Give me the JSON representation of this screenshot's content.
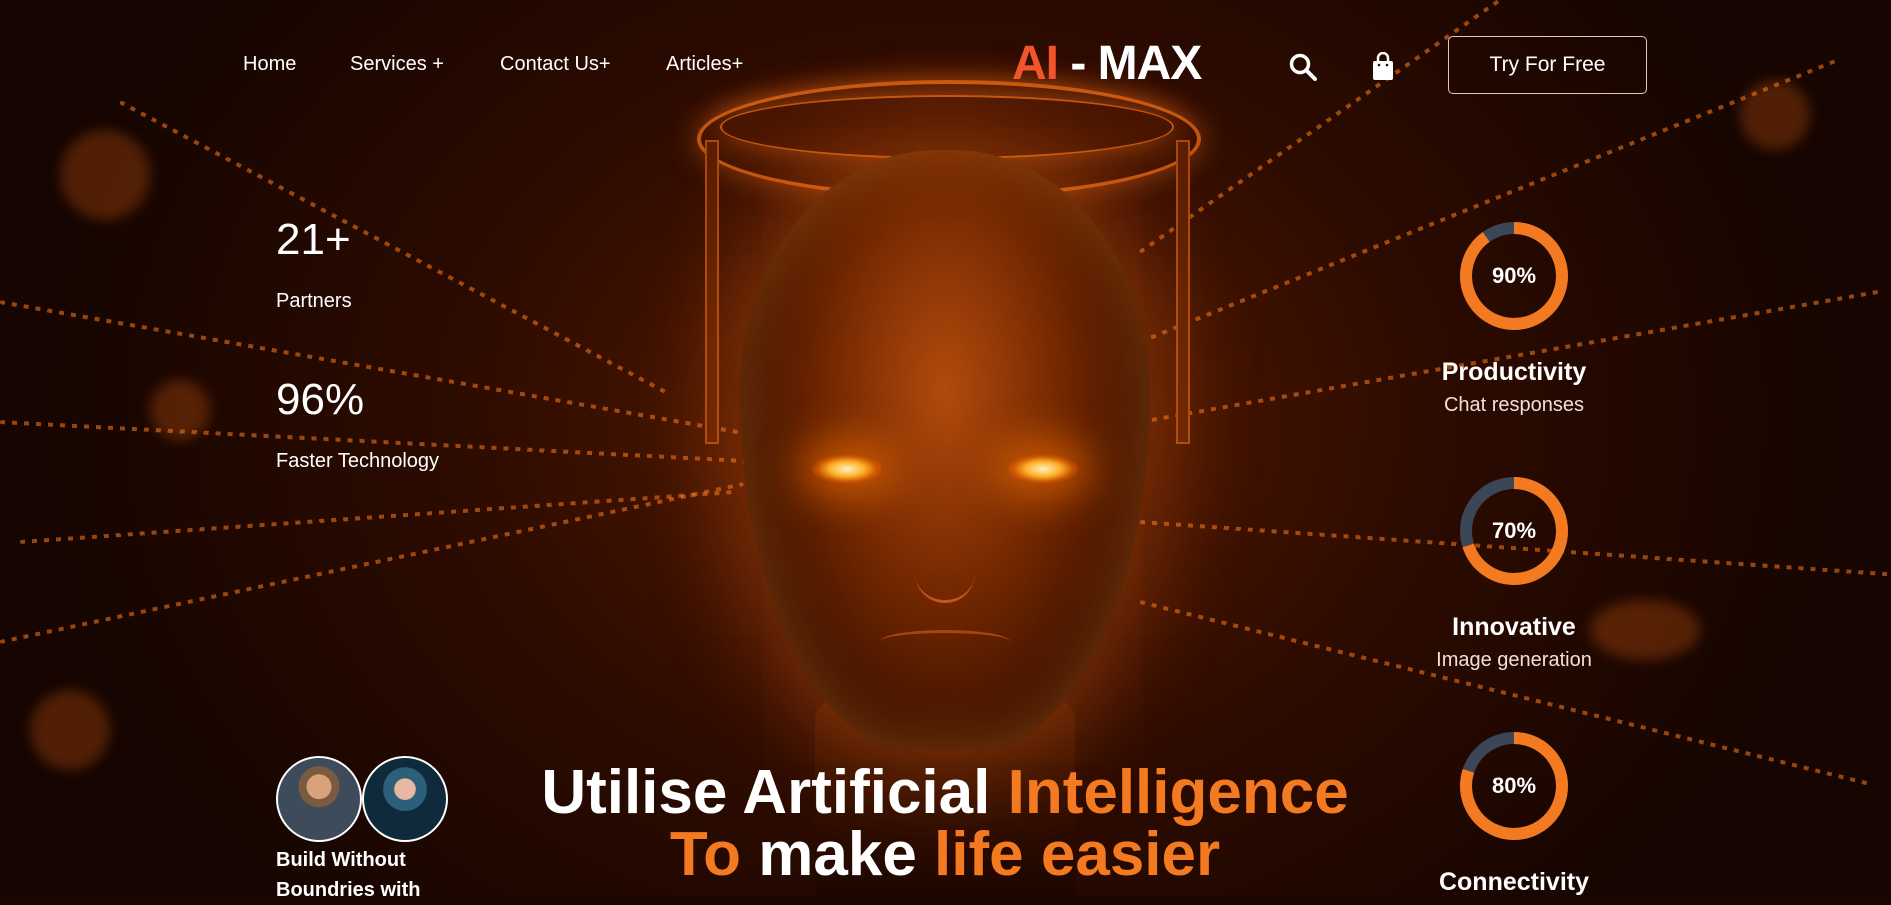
{
  "nav": {
    "links": [
      {
        "label": "Home"
      },
      {
        "label": "Services +"
      },
      {
        "label": "Contact Us+"
      },
      {
        "label": "Articles+"
      }
    ],
    "logo": {
      "part1": "AI",
      "part2": " - MAX"
    },
    "search_icon": "search-icon",
    "cart_icon": "shopping-bag-icon",
    "cta_label": "Try For Free"
  },
  "stats": [
    {
      "value": "21+",
      "label": "Partners"
    },
    {
      "value": "96%",
      "label": "Faster Technology"
    }
  ],
  "gauges": [
    {
      "percent_label": "90%",
      "percent": 0.9,
      "title": "Productivity",
      "subtitle": "Chat responses"
    },
    {
      "percent_label": "70%",
      "percent": 0.7,
      "title": "Innovative",
      "subtitle": "Image generation"
    },
    {
      "percent_label": "80%",
      "percent": 0.8,
      "title": "Connectivity",
      "subtitle": ""
    }
  ],
  "community": {
    "text": "Build Without Boundries with"
  },
  "hero": {
    "line1_white": "Utilise Artificial ",
    "line1_orange": "Intelligence",
    "line2_orange_a": "To ",
    "line2_white": "make ",
    "line2_orange_b": "life easier"
  },
  "colors": {
    "accent_orange": "#f47a22",
    "logo_red": "#f2552c",
    "gauge_track": "#3b4656"
  }
}
